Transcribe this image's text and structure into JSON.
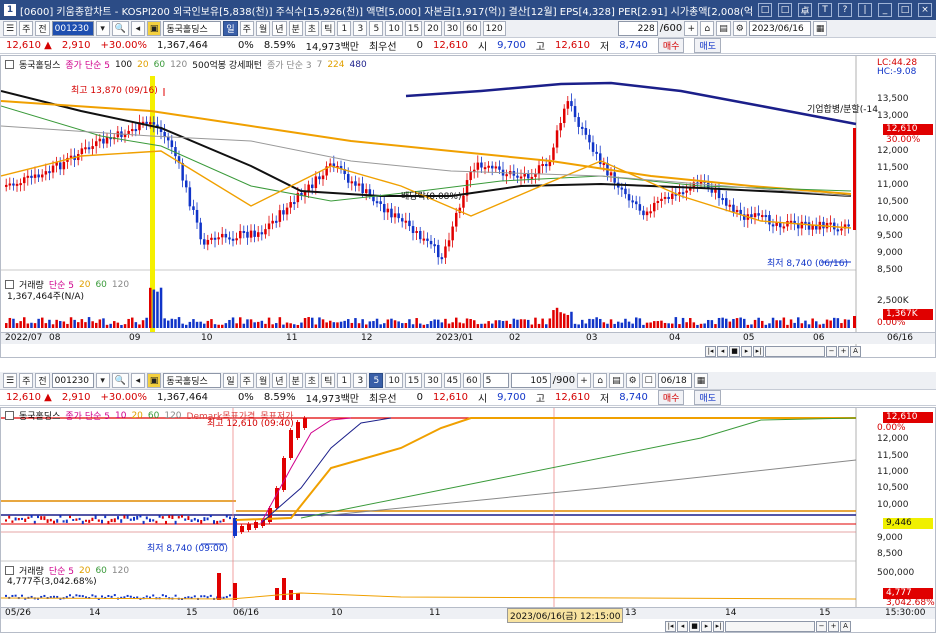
{
  "window": {
    "app_id": "1",
    "title": "[0600] 키움종합차트 - KOSPI200 외국인보유[5,838(천)] 주식수[15,926(천)] 액면[5,000] 자본금[1,917(억)] 결산[12월] EPS[4,328] PER[2.91] 시가총액[2,008(억)] 유통비율[69.4]",
    "buttons": [
      "□",
      "□",
      "卓",
      "T",
      "?",
      "|",
      "_",
      "□",
      "×"
    ]
  },
  "top_toolbar": {
    "mode": "주",
    "view": "전",
    "code": "001230",
    "stock_name": "동국홀딩스",
    "periods": [
      "일",
      "주",
      "월",
      "년",
      "분",
      "초",
      "틱",
      "1",
      "3",
      "5",
      "10",
      "15",
      "20",
      "30",
      "60",
      "120"
    ],
    "active_period": "일",
    "count": "228",
    "count_total": "/600",
    "date": "2023/06/16"
  },
  "top_info": {
    "price": "12,610",
    "change": "2,910",
    "change_pct": "+30.00%",
    "volume": "1,367,464",
    "turnover_label": "0%",
    "turnover": "8.59%",
    "amount": "14,973백만",
    "priority": "최우선",
    "zero": "0",
    "quote": "12,610",
    "open_label": "시",
    "open": "9,700",
    "high_label": "고",
    "high": "12,610",
    "low_label": "저",
    "low": "8,740",
    "buy": "매수",
    "sell": "매도"
  },
  "top_chart": {
    "legend": [
      "동국홀딩스",
      "종가 단순 5",
      "100",
      "20",
      "60",
      "120",
      "500억봉 강세패턴",
      "종가 단순 3",
      "7",
      "224",
      "480"
    ],
    "annotations": {
      "high": "최고 13,870 (09/16)",
      "low": "최저 8,740 (06/16)",
      "dividend": "배당락(0.08%)",
      "merger": "기업합병/분할(-14"
    },
    "y_ticks": [
      "13,500",
      "13,000",
      "12,500",
      "12,000",
      "11,500",
      "11,000",
      "10,500",
      "10,000",
      "9,500",
      "9,000",
      "8,500"
    ],
    "lc": "LC:44.28",
    "hc": "HC:-9.08",
    "last_price": "12,610",
    "last_pct": "30.00%",
    "volume_legend": [
      "거래량",
      "단순 5",
      "20",
      "60",
      "120"
    ],
    "volume_value": "1,367,464주(N/A)",
    "vol_ticks": [
      "2,500K",
      "1,367K",
      "0.00%"
    ],
    "x_labels": [
      "2022/07",
      "08",
      "09",
      "10",
      "11",
      "12",
      "2023/01",
      "02",
      "03",
      "04",
      "05",
      "06",
      "06/16"
    ]
  },
  "bottom_toolbar": {
    "mode": "주",
    "view": "전",
    "code": "001230",
    "stock_name": "동국홀딩스",
    "periods": [
      "일",
      "주",
      "월",
      "년",
      "분",
      "초",
      "틱",
      "1",
      "3",
      "5",
      "10",
      "15",
      "30",
      "45",
      "60"
    ],
    "active_period": "5",
    "interval": "5",
    "count": "105",
    "count_total": "/900",
    "date": "06/18"
  },
  "bottom_info": {
    "price": "12,610",
    "change": "2,910",
    "change_pct": "+30.00%",
    "volume": "1,367,464",
    "turnover_label": "0%",
    "turnover": "8.59%",
    "amount": "14,973백만",
    "priority": "최우선",
    "zero": "0",
    "quote": "12,610",
    "open_label": "시",
    "open": "9,700",
    "high_label": "고",
    "high": "12,610",
    "low_label": "저",
    "low": "8,740",
    "buy": "매수",
    "sell": "매도"
  },
  "bottom_chart": {
    "legend": [
      "동국홀딩스",
      "종가 단순 5",
      "10",
      "20",
      "60",
      "120",
      "Demark목표가격",
      "목표저가"
    ],
    "annotations": {
      "high": "최고 12,610 (09:40)",
      "low": "최저 8,740 (09:00)",
      "cursor_date": "2023/06/16(금) 12:15:00"
    },
    "y_ticks": [
      "12,610",
      "0.00%",
      "12,000",
      "11,500",
      "11,000",
      "10,500",
      "10,000",
      "9,446",
      "9,000",
      "8,500"
    ],
    "volume_legend": [
      "거래량",
      "단순 5",
      "20",
      "60",
      "120"
    ],
    "volume_value": "4,777주(3,042.68%)",
    "vol_ticks": [
      "500,000",
      "4,777",
      "3,042.68%"
    ],
    "x_labels": [
      "05/26",
      "14",
      "15",
      "06/16",
      "10",
      "11",
      "13",
      "14",
      "15",
      "15:30:00"
    ]
  },
  "colors": {
    "up": "#e00000",
    "down": "#1034c8",
    "ma_orange": "#f0a000",
    "ma_black": "#111111",
    "ma_navy": "#1b1f8a",
    "ma_green": "#3a9a3a",
    "highlight": "#f5f000"
  }
}
